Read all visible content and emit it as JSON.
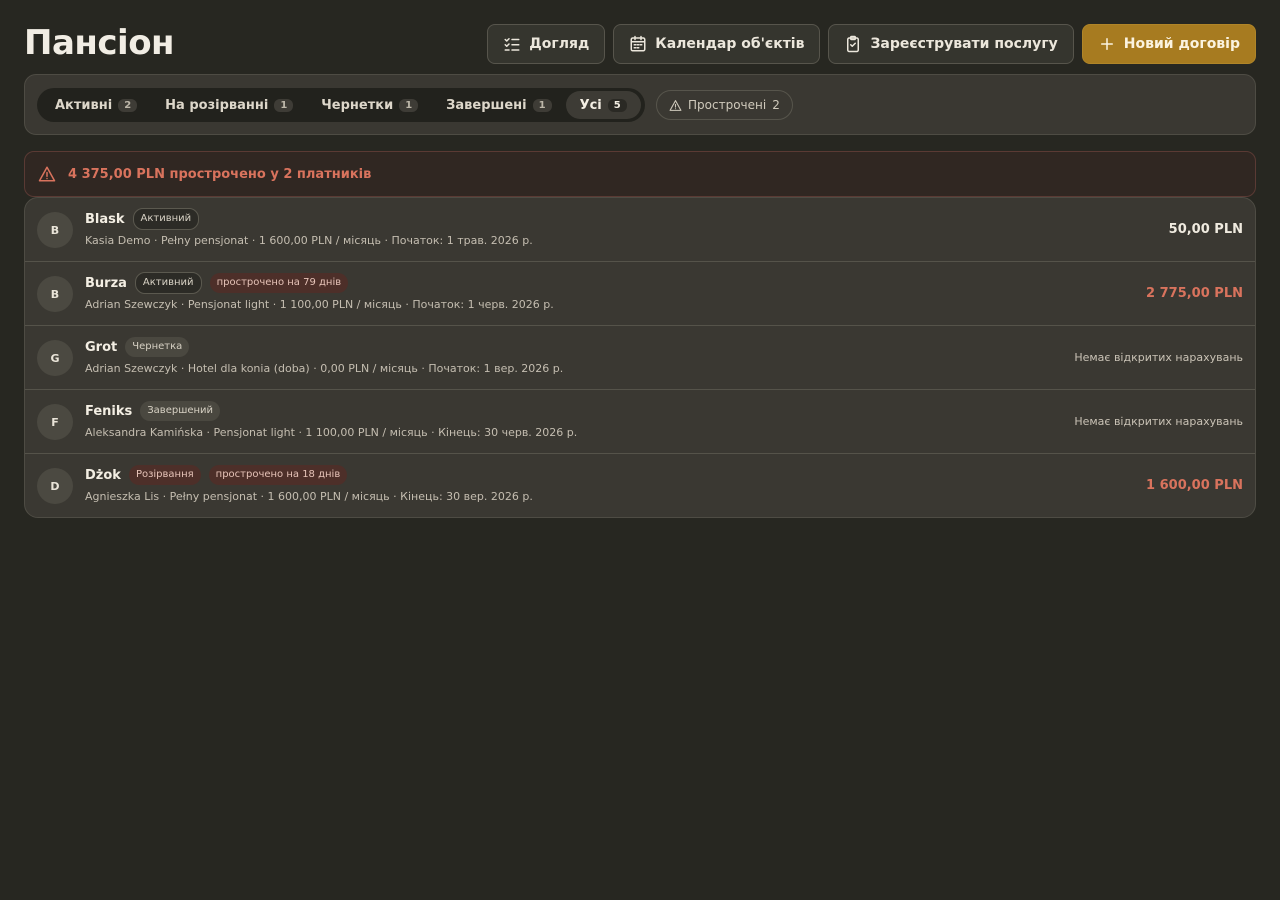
{
  "page": {
    "title": "Пансіон"
  },
  "header": {
    "actions": [
      {
        "label": "Догляд",
        "icon": "care-checklist-icon"
      },
      {
        "label": "Календар об'єктів",
        "icon": "calendar-icon"
      },
      {
        "label": "Зареєструвати послугу",
        "icon": "clipboard-check-icon"
      },
      {
        "label": "Новий договір",
        "icon": "plus-icon"
      }
    ]
  },
  "filters": {
    "tabs": [
      {
        "label": "Активні",
        "count": "2"
      },
      {
        "label": "На розірванні",
        "count": "1"
      },
      {
        "label": "Чернетки",
        "count": "1"
      },
      {
        "label": "Завершені",
        "count": "1"
      },
      {
        "label": "Усі",
        "count": "5"
      }
    ],
    "active_tab": "Усі",
    "overdue": {
      "label": "Прострочені",
      "count": "2",
      "icon": "warning-triangle-icon"
    }
  },
  "alert": {
    "text": "4 375,00 PLN прострочено у 2 платників",
    "icon": "warning-triangle-icon"
  },
  "contracts": [
    {
      "initial": "B",
      "name": "Blask",
      "status": "Активний",
      "overdue": "",
      "details": "Kasia Demo · Pełny pensjonat · 1 600,00 PLN / місяць · Початок: 1 трав. 2026 р.",
      "amount": "50,00 PLN"
    },
    {
      "initial": "B",
      "name": "Burza",
      "status": "Активний",
      "overdue": "прострочено на 79 днів",
      "details": "Adrian Szewczyk · Pensjonat light · 1 100,00 PLN / місяць · Початок: 1 черв. 2026 р.",
      "amount": "2 775,00 PLN"
    },
    {
      "initial": "G",
      "name": "Grot",
      "status": "Чернетка",
      "overdue": "",
      "details": "Adrian Szewczyk · Hotel dla konia (doba) · 0,00 PLN / місяць · Початок: 1 вер. 2026 р.",
      "amount": "Немає відкритих нарахувань"
    },
    {
      "initial": "F",
      "name": "Feniks",
      "status": "Завершений",
      "overdue": "",
      "details": "Aleksandra Kamińska · Pensjonat light · 1 100,00 PLN / місяць · Кінець: 30 черв. 2026 р.",
      "amount": "Немає відкритих нарахувань"
    },
    {
      "initial": "D",
      "name": "Dżok",
      "status": "Розірвання",
      "overdue": "прострочено на 18 днів",
      "details": "Agnieszka Lis · Pełny pensjonat · 1 600,00 PLN / місяць · Кінець: 30 вер. 2026 р.",
      "amount": "1 600,00 PLN"
    }
  ],
  "colors": {
    "background": "#272721",
    "accent": "#a77b20",
    "overdue": "#d9735d"
  }
}
